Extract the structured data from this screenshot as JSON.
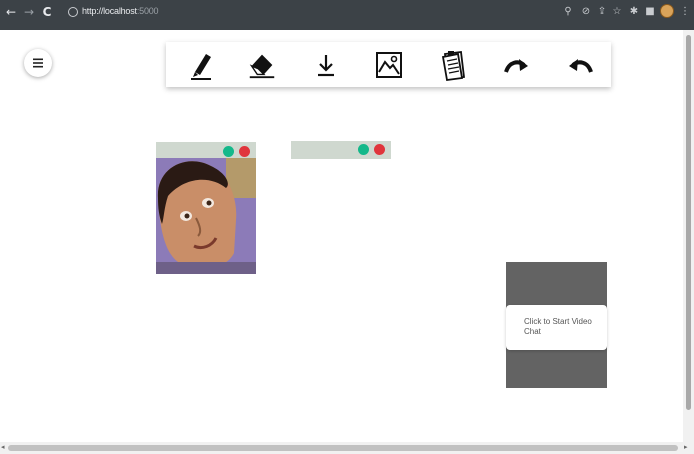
{
  "browser": {
    "url_host": "http://localhost",
    "url_port": ":5000",
    "nav_icons": [
      "back-arrow-icon",
      "forward-arrow-icon",
      "reload-icon"
    ],
    "right_icons": [
      "zoom-icon",
      "camera-blocked-icon",
      "share-icon",
      "star-icon",
      "extensions-icon",
      "sidebar-icon",
      "profile-icon",
      "menu-dots-icon"
    ]
  },
  "toolbar": {
    "tools": [
      {
        "name": "pencil-tool",
        "icon": "pencil-icon"
      },
      {
        "name": "eraser-tool",
        "icon": "eraser-icon"
      },
      {
        "name": "download-tool",
        "icon": "download-icon"
      },
      {
        "name": "image-tool",
        "icon": "image-icon"
      },
      {
        "name": "notes-tool",
        "icon": "notepad-icon"
      },
      {
        "name": "redo-tool",
        "icon": "redo-icon"
      },
      {
        "name": "undo-tool",
        "icon": "undo-icon"
      }
    ]
  },
  "video_chat": {
    "prompt": "Click to Start Video Chat"
  },
  "colors": {
    "chrome_bar": "#3c4247",
    "card_bar": "#cfd8cf",
    "green_dot": "#14b88a",
    "red_dot": "#e0353c",
    "chat_panel": "#636363"
  }
}
